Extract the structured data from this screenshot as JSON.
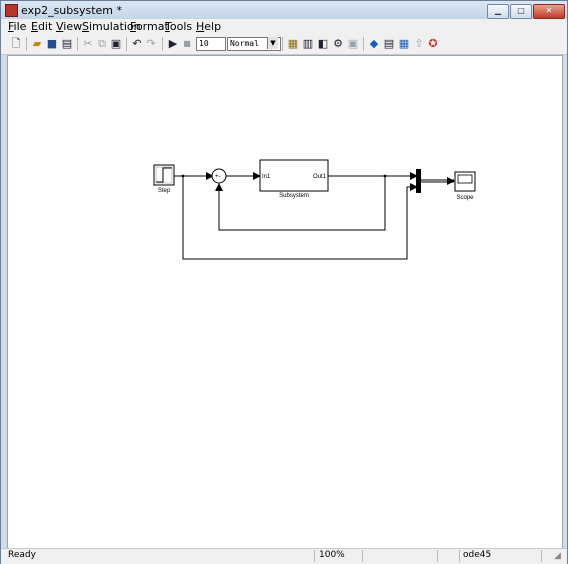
{
  "window": {
    "title": "exp2_subsystem *"
  },
  "menubar": {
    "items": [
      "File",
      "Edit",
      "View",
      "Simulation",
      "Format",
      "Tools",
      "Help"
    ]
  },
  "toolbar": {
    "stop_time": "10",
    "sim_mode": "Normal"
  },
  "diagram": {
    "step_label": "Step",
    "subsystem_label": "Subsystem",
    "subsystem_in_port": "In1",
    "subsystem_out_port": "Out1",
    "scope_label": "Scope",
    "sum_signs": "+-"
  },
  "statusbar": {
    "status": "Ready",
    "zoom": "100%",
    "solver": "ode45"
  }
}
